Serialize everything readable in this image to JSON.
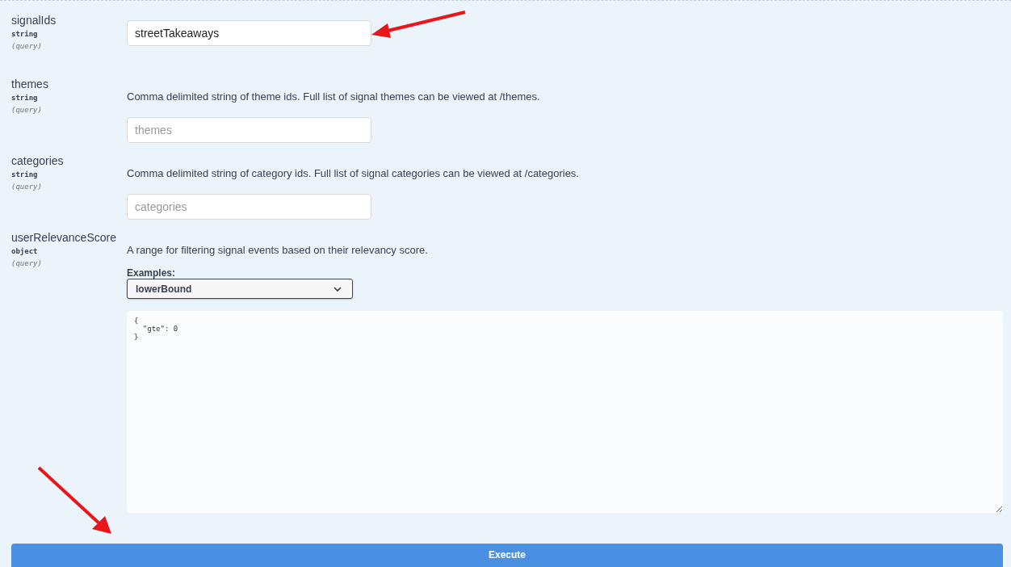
{
  "parameters": [
    {
      "kind": "text",
      "name": "signalIds",
      "type": "string",
      "location": "(query)",
      "value": "streetTakeaways"
    },
    {
      "kind": "text",
      "name": "themes",
      "type": "string",
      "location": "(query)",
      "description": "Comma delimited string of theme ids. Full list of signal themes can be viewed at /themes.",
      "placeholder": "themes"
    },
    {
      "kind": "text",
      "name": "categories",
      "type": "string",
      "location": "(query)",
      "description": "Comma delimited string of category ids. Full list of signal categories can be viewed at /categories.",
      "placeholder": "categories"
    },
    {
      "kind": "json",
      "name": "userRelevanceScore",
      "type": "object",
      "location": "(query)",
      "description": "A range for filtering signal events based on their relevancy score.",
      "examples_label": "Examples:",
      "example_selected": "lowerBound",
      "body": "{\n  \"gte\": 0\n}"
    }
  ],
  "execute_button": "Execute"
}
